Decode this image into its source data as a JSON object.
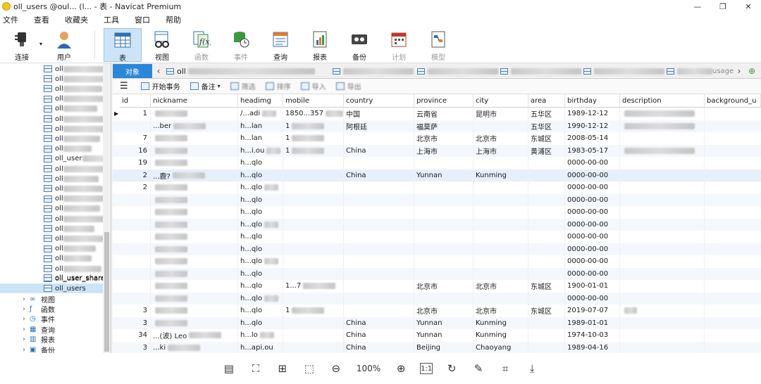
{
  "window": {
    "title": "oll_users @oul... (l... - 表 - Navicat Premium",
    "min": "—",
    "max": "❐",
    "close": "✕"
  },
  "menu": [
    "文件",
    "查看",
    "收藏夹",
    "工具",
    "窗口",
    "帮助"
  ],
  "toolbar": {
    "connect": "连接",
    "user": "用户",
    "table": "表",
    "view": "视图",
    "function": "函数",
    "event": "事件",
    "query": "查询",
    "report": "报表",
    "backup": "备份",
    "schedule": "计划",
    "model": "模型"
  },
  "sidebar": {
    "partial_names": [
      "oll",
      "oll",
      "oll",
      "oll",
      "oll",
      "oll",
      "oll",
      "oll",
      "oll",
      "oll_user",
      "oll",
      "oll",
      "oll",
      "oll",
      "oll",
      "oll",
      "oll",
      "oll",
      "oll",
      "oll",
      "oll",
      "oll_user_share"
    ],
    "user_shares": "oll_user_shares",
    "selected": "oll_users",
    "groups": [
      "视图",
      "函数",
      "事件",
      "查询",
      "报表",
      "备份"
    ]
  },
  "tabs": {
    "objects": "对象",
    "first_tab": "oll",
    "last_tab_suffix": "usage"
  },
  "gridtoolbar": {
    "menu": "☰",
    "begin_tx": "开始事务",
    "memo": "备注",
    "filter": "筛选",
    "sort": "排序",
    "import": "导入",
    "export": "导出"
  },
  "columns": [
    "id",
    "nickname",
    "headimg",
    "mobile",
    "country",
    "province",
    "city",
    "area",
    "birthday",
    "description",
    "background_u"
  ],
  "rows": [
    {
      "id": "1",
      "nickname": "",
      "headimg": "/...adi",
      "mobile": "1850...357",
      "country": "中国",
      "province": "云南省",
      "city": "昆明市",
      "area": "五华区",
      "birthday": "1989-12-12",
      "description": ""
    },
    {
      "id": "",
      "nickname": "...ber",
      "headimg": "h...lan",
      "mobile": "1",
      "country": "阿根廷",
      "province": "福莫萨",
      "city": "",
      "area": "五华区",
      "birthday": "1990-12-12",
      "description": ""
    },
    {
      "id": "7",
      "nickname": "",
      "headimg": "h...lan",
      "mobile": "1",
      "country": "",
      "province": "北京市",
      "city": "北京市",
      "area": "东城区",
      "birthday": "2008-05-14",
      "description": ""
    },
    {
      "id": "16",
      "nickname": "",
      "headimg": "h...i.ou",
      "mobile": "1",
      "country": "China",
      "province": "上海市",
      "city": "上海市",
      "area": "黄浦区",
      "birthday": "1983-05-17",
      "description": ""
    },
    {
      "id": "19",
      "nickname": "",
      "headimg": "h...qlo",
      "mobile": "",
      "country": "",
      "province": "",
      "city": "",
      "area": "",
      "birthday": "0000-00-00",
      "description": ""
    },
    {
      "id": "2",
      "nickname": "...鹿?",
      "headimg": "h...qlo",
      "mobile": "",
      "country": "China",
      "province": "Yunnan",
      "city": "Kunming",
      "area": "",
      "birthday": "0000-00-00",
      "description": ""
    },
    {
      "id": "2",
      "nickname": "",
      "headimg": "h...qlo",
      "mobile": "",
      "country": "",
      "province": "",
      "city": "",
      "area": "",
      "birthday": "0000-00-00",
      "description": ""
    },
    {
      "id": "",
      "nickname": "",
      "headimg": "h...qlo",
      "mobile": "",
      "country": "",
      "province": "",
      "city": "",
      "area": "",
      "birthday": "0000-00-00",
      "description": ""
    },
    {
      "id": "",
      "nickname": "",
      "headimg": "h...qlo",
      "mobile": "",
      "country": "",
      "province": "",
      "city": "",
      "area": "",
      "birthday": "0000-00-00",
      "description": ""
    },
    {
      "id": "",
      "nickname": "",
      "headimg": "h...qlo",
      "mobile": "",
      "country": "",
      "province": "",
      "city": "",
      "area": "",
      "birthday": "0000-00-00",
      "description": ""
    },
    {
      "id": "",
      "nickname": "",
      "headimg": "h...qlo",
      "mobile": "",
      "country": "",
      "province": "",
      "city": "",
      "area": "",
      "birthday": "0000-00-00",
      "description": ""
    },
    {
      "id": "",
      "nickname": "",
      "headimg": "h...qlo",
      "mobile": "",
      "country": "",
      "province": "",
      "city": "",
      "area": "",
      "birthday": "0000-00-00",
      "description": ""
    },
    {
      "id": "",
      "nickname": "",
      "headimg": "h...qlo",
      "mobile": "",
      "country": "",
      "province": "",
      "city": "",
      "area": "",
      "birthday": "0000-00-00",
      "description": ""
    },
    {
      "id": "",
      "nickname": "",
      "headimg": "h...qlo",
      "mobile": "",
      "country": "",
      "province": "",
      "city": "",
      "area": "",
      "birthday": "0000-00-00",
      "description": ""
    },
    {
      "id": "",
      "nickname": "",
      "headimg": "h...qlo",
      "mobile": "1...7",
      "country": "",
      "province": "北京市",
      "city": "北京市",
      "area": "东城区",
      "birthday": "1900-01-01",
      "description": ""
    },
    {
      "id": "",
      "nickname": "",
      "headimg": "h...qlo",
      "mobile": "",
      "country": "",
      "province": "",
      "city": "",
      "area": "",
      "birthday": "0000-00-00",
      "description": ""
    },
    {
      "id": "3",
      "nickname": "",
      "headimg": "h...qlo",
      "mobile": "1",
      "country": "",
      "province": "北京市",
      "city": "北京市",
      "area": "东城区",
      "birthday": "2019-07-07",
      "description": ""
    },
    {
      "id": "3",
      "nickname": "",
      "headimg": "h...qlo",
      "mobile": "",
      "country": "China",
      "province": "Yunnan",
      "city": "Kunming",
      "area": "",
      "birthday": "1989-01-01",
      "description": ""
    },
    {
      "id": "34",
      "nickname": "...(波) Leo",
      "headimg": "h...lo",
      "mobile": "",
      "country": "China",
      "province": "Yunnan",
      "city": "Kunming",
      "area": "",
      "birthday": "1974-10-03",
      "description": ""
    },
    {
      "id": "3",
      "nickname": "...ki",
      "headimg": "h...api.ou",
      "mobile": "",
      "country": "China",
      "province": "Beijing",
      "city": "Chaoyang",
      "area": "",
      "birthday": "1989-04-16",
      "description": ""
    }
  ],
  "statusbar": {
    "zoom": "100%"
  }
}
